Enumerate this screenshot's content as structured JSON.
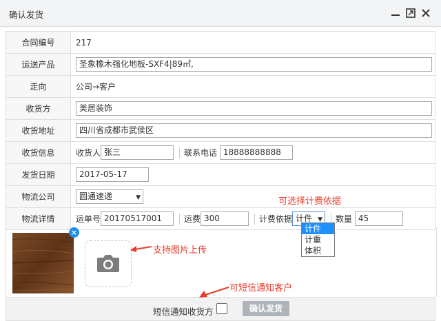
{
  "window": {
    "title": "确认发货",
    "controls": [
      "minimize-icon",
      "maximize-icon",
      "close-icon"
    ]
  },
  "form": {
    "contract_no": {
      "label": "合同编号",
      "value": "217"
    },
    "product": {
      "label": "运送产品",
      "value": "圣象橡木强化地板-SXF4|89㎡,"
    },
    "direction": {
      "label": "走向",
      "value": "公司→客户"
    },
    "recipient": {
      "label": "收货方",
      "value": "美居装饰"
    },
    "address": {
      "label": "收货地址",
      "value": "四川省成都市武侯区"
    },
    "consignee_info": {
      "label": "收货信息",
      "name_label": "收货人",
      "name_value": "张三",
      "phone_label": "联系电话",
      "phone_value": "18888888888"
    },
    "ship_date": {
      "label": "发货日期",
      "value": "2017-05-17"
    },
    "logistics_company": {
      "label": "物流公司",
      "selected": "圆通速递"
    },
    "logistics_detail": {
      "label": "物流详情",
      "tracking_label": "运单号",
      "tracking_value": "20170517001",
      "fee_label": "运费",
      "fee_value": "300",
      "basis_label": "计费依据",
      "basis_selected": "计件",
      "basis_options": [
        "计件",
        "计重",
        "体积"
      ],
      "qty_label": "数量",
      "qty_value": "45"
    }
  },
  "footer": {
    "sms_label": "短信通知收货方",
    "sms_checked": false,
    "confirm_label": "确认发货"
  },
  "annotations": {
    "basis_note": "可选择计费依据",
    "upload_note": "支持图片上传",
    "sms_note": "可短信通知客户",
    "color": "#e83a2a"
  },
  "colors": {
    "accent": "#1e90ff",
    "button_disabled": "#aeb4ba"
  }
}
